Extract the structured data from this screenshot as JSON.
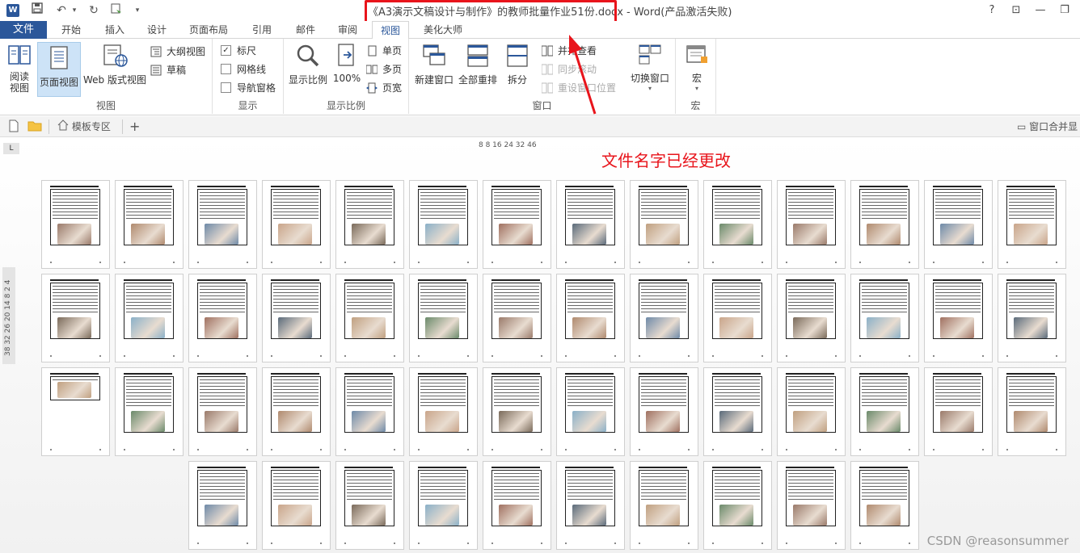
{
  "titlebar": {
    "app_icon": "W",
    "title": "《A3演示文稿设计与制作》的教师批量作业51份.docx - Word(产品激活失败)",
    "help": "?",
    "ribbon_display": "⊡",
    "minimize": "—",
    "restore": "❐"
  },
  "tabs": {
    "file": "文件",
    "items": [
      "开始",
      "插入",
      "设计",
      "页面布局",
      "引用",
      "邮件",
      "审阅",
      "视图",
      "美化大师"
    ],
    "active": "视图"
  },
  "ribbon": {
    "groups": {
      "views": "视图",
      "show": "显示",
      "zoom": "显示比例",
      "window": "窗口",
      "macros": "宏"
    },
    "read_mode": "阅读\n视图",
    "print_layout": "页面视图",
    "web_layout": "Web 版式视图",
    "outline": "大纲视图",
    "draft": "草稿",
    "ruler": "标尺",
    "gridlines": "网格线",
    "nav_pane": "导航窗格",
    "zoom": "显示比例",
    "zoom_100": "100%",
    "one_page": "单页",
    "multi_page": "多页",
    "page_width": "页宽",
    "new_window": "新建窗口",
    "arrange_all": "全部重排",
    "split": "拆分",
    "side_by_side": "并排查看",
    "sync_scroll": "同步滚动",
    "reset_position": "重设窗口位置",
    "switch_windows": "切换窗口",
    "macros": "宏"
  },
  "docbar": {
    "template_tab": "模板专区",
    "add": "+",
    "merge": "窗口合并显"
  },
  "rulers": {
    "corner": "L",
    "horizontal": "8   8 16 24 32  46",
    "vertical": "38 32 26 20 14  8  2  4"
  },
  "annotation": "文件名字已经更改",
  "watermark": "CSDN @reasonsummer",
  "colors": {
    "accent": "#2b579a",
    "highlight": "#e8141b"
  },
  "icons": [
    "word-icon",
    "save-icon",
    "undo-icon",
    "redo-icon",
    "touch-mode-icon",
    "new-doc-icon",
    "folder-icon",
    "home-icon"
  ]
}
